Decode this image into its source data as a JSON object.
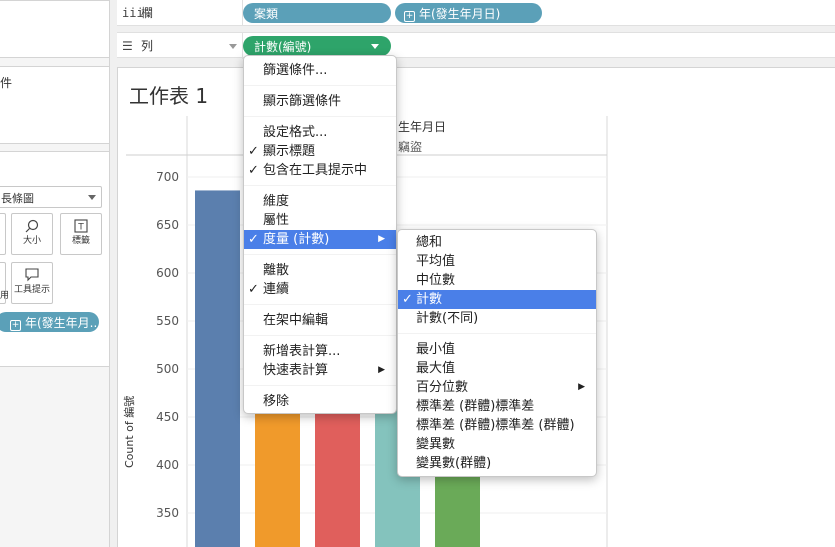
{
  "left_panel": {
    "filters_fragment": "件",
    "marktype_value": "長條圖",
    "mark_buttons": [
      {
        "label": "大小",
        "icon": "size-icon"
      },
      {
        "label": "標籤",
        "icon": "label-icon"
      },
      {
        "label": "工具提示",
        "icon": "tooltip-icon"
      }
    ],
    "detail_pill": "年(發生年月..",
    "detail_fragment": "用"
  },
  "shelves": {
    "columns": {
      "icon": "iii",
      "label": "欄",
      "pills": [
        "案類",
        "年(發生年月日)"
      ]
    },
    "rows": {
      "icon": "☰",
      "label": "列",
      "pills": [
        "計數(編號)"
      ]
    }
  },
  "sheet": {
    "title": "工作表 1",
    "header_top": "生年月日",
    "header_sub": "竊盜"
  },
  "chart_data": {
    "type": "bar",
    "ylabel": "Count of 編號",
    "ylim": [
      320,
      720
    ],
    "y_ticks": [
      350,
      400,
      450,
      500,
      550,
      600,
      650,
      700
    ],
    "bars": [
      {
        "value": 686,
        "color": "#5b7fae"
      },
      {
        "value": 600,
        "color": "#f09a2b"
      },
      {
        "value": 600,
        "color": "#e05f5c"
      },
      {
        "value": 600,
        "color": "#84c3bd"
      },
      {
        "value": 600,
        "color": "#6aaa58"
      }
    ]
  },
  "context_menu": {
    "items": [
      {
        "label": "篩選條件...",
        "checked": false,
        "submenu": false
      },
      {
        "label": "顯示篩選條件",
        "checked": false,
        "submenu": false
      },
      {
        "label": "設定格式...",
        "checked": false,
        "submenu": false
      },
      {
        "label": "顯示標題",
        "checked": true,
        "submenu": false
      },
      {
        "label": "包含在工具提示中",
        "checked": true,
        "submenu": false
      },
      {
        "label": "維度",
        "checked": false,
        "submenu": false
      },
      {
        "label": "屬性",
        "checked": false,
        "submenu": false
      },
      {
        "label": "度量 (計數)",
        "checked": true,
        "submenu": true,
        "highlighted": true
      },
      {
        "label": "離散",
        "checked": false,
        "submenu": false
      },
      {
        "label": "連續",
        "checked": true,
        "submenu": false
      },
      {
        "label": "在架中編輯",
        "checked": false,
        "submenu": false
      },
      {
        "label": "新增表計算...",
        "checked": false,
        "submenu": false
      },
      {
        "label": "快速表計算",
        "checked": false,
        "submenu": true
      },
      {
        "label": "移除",
        "checked": false,
        "submenu": false
      }
    ]
  },
  "measure_submenu": {
    "items": [
      {
        "label": "總和",
        "checked": false
      },
      {
        "label": "平均值",
        "checked": false
      },
      {
        "label": "中位數",
        "checked": false
      },
      {
        "label": "計數",
        "checked": true,
        "highlighted": true
      },
      {
        "label": "計數(不同)",
        "checked": false
      },
      {
        "label": "最小值",
        "checked": false
      },
      {
        "label": "最大值",
        "checked": false
      },
      {
        "label": "百分位數",
        "checked": false,
        "submenu": true
      },
      {
        "label": "標準差 (群體)標準差",
        "checked": false
      },
      {
        "label": "標準差 (群體)標準差 (群體)",
        "checked": false
      },
      {
        "label": "變異數",
        "checked": false
      },
      {
        "label": "變異數(群體)",
        "checked": false
      }
    ]
  },
  "colors": {
    "pill_dimension": "#5ba0b8",
    "pill_measure": "#2ea46a",
    "menu_highlight": "#4a7fe8"
  }
}
